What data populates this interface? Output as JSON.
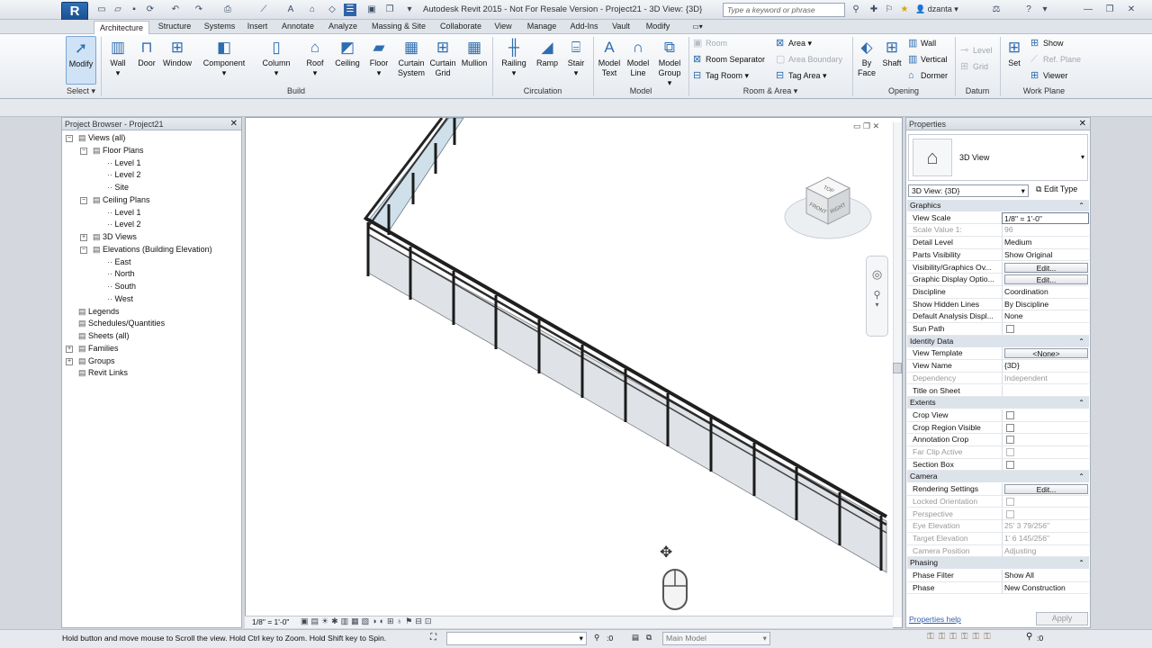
{
  "title_bar": {
    "window_title": "Autodesk Revit 2015 -  Not For Resale Version -    Project21 - 3D View: {3D}",
    "search_placeholder": "Type a keyword or phrase",
    "user": "dzanta",
    "app_letter": "R"
  },
  "tabs": [
    "Architecture",
    "Structure",
    "Systems",
    "Insert",
    "Annotate",
    "Analyze",
    "Massing & Site",
    "Collaborate",
    "View",
    "Manage",
    "Add-Ins",
    "Vault",
    "Modify"
  ],
  "ribbon": {
    "select": {
      "modify": "Modify",
      "label": "Select"
    },
    "build": {
      "wall": "Wall",
      "door": "Door",
      "window": "Window",
      "component": "Component",
      "column": "Column",
      "roof": "Roof",
      "ceiling": "Ceiling",
      "floor": "Floor",
      "curtain_system": "Curtain System",
      "curtain_grid": "Curtain Grid",
      "mullion": "Mullion",
      "label": "Build"
    },
    "circulation": {
      "railing": "Railing",
      "ramp": "Ramp",
      "stair": "Stair",
      "label": "Circulation"
    },
    "model": {
      "model_text": "Model Text",
      "model_line": "Model Line",
      "model_group": "Model Group",
      "label": "Model"
    },
    "room_area": {
      "room": "Room",
      "room_separator": "Room Separator",
      "tag_room": "Tag Room",
      "area": "Area",
      "area_boundary": "Area Boundary",
      "tag_area": "Tag Area",
      "label": "Room & Area"
    },
    "opening": {
      "by_face": "By Face",
      "shaft": "Shaft",
      "wall": "Wall",
      "vertical": "Vertical",
      "dormer": "Dormer",
      "label": "Opening"
    },
    "datum": {
      "level": "Level",
      "grid": "Grid",
      "label": "Datum"
    },
    "work_plane": {
      "set": "Set",
      "show": "Show",
      "ref_plane": "Ref. Plane",
      "viewer": "Viewer",
      "label": "Work Plane"
    }
  },
  "project_browser": {
    "title": "Project Browser - Project21",
    "items": [
      {
        "label": "Views (all)",
        "depth": 0,
        "toggle": "-"
      },
      {
        "label": "Floor Plans",
        "depth": 1,
        "toggle": "-"
      },
      {
        "label": "Level 1",
        "depth": 2,
        "toggle": ""
      },
      {
        "label": "Level 2",
        "depth": 2,
        "toggle": ""
      },
      {
        "label": "Site",
        "depth": 2,
        "toggle": ""
      },
      {
        "label": "Ceiling Plans",
        "depth": 1,
        "toggle": "-"
      },
      {
        "label": "Level 1",
        "depth": 2,
        "toggle": ""
      },
      {
        "label": "Level 2",
        "depth": 2,
        "toggle": ""
      },
      {
        "label": "3D Views",
        "depth": 1,
        "toggle": "+"
      },
      {
        "label": "Elevations (Building Elevation)",
        "depth": 1,
        "toggle": "-"
      },
      {
        "label": "East",
        "depth": 2,
        "toggle": ""
      },
      {
        "label": "North",
        "depth": 2,
        "toggle": ""
      },
      {
        "label": "South",
        "depth": 2,
        "toggle": ""
      },
      {
        "label": "West",
        "depth": 2,
        "toggle": ""
      },
      {
        "label": "Legends",
        "depth": 0,
        "toggle": ""
      },
      {
        "label": "Schedules/Quantities",
        "depth": 0,
        "toggle": ""
      },
      {
        "label": "Sheets (all)",
        "depth": 0,
        "toggle": ""
      },
      {
        "label": "Families",
        "depth": 0,
        "toggle": "+"
      },
      {
        "label": "Groups",
        "depth": 0,
        "toggle": "+"
      },
      {
        "label": "Revit Links",
        "depth": 0,
        "toggle": ""
      }
    ]
  },
  "view": {
    "scale": "1/8\" = 1'-0\"",
    "viewcube": {
      "top": "TOP",
      "front": "FRONT",
      "right": "RIGHT"
    }
  },
  "properties": {
    "title": "Properties",
    "type_name": "3D View",
    "view_selector": "3D View: {3D}",
    "edit_type": "Edit Type",
    "groups": {
      "graphics": "Graphics",
      "identity": "Identity Data",
      "extents": "Extents",
      "camera": "Camera",
      "phasing": "Phasing"
    },
    "rows": {
      "view_scale": {
        "k": "View Scale",
        "v": "1/8\" = 1'-0\""
      },
      "scale_value": {
        "k": "Scale Value    1:",
        "v": "96"
      },
      "detail_level": {
        "k": "Detail Level",
        "v": "Medium"
      },
      "parts_visibility": {
        "k": "Parts Visibility",
        "v": "Show Original"
      },
      "vis_graphics": {
        "k": "Visibility/Graphics Ov...",
        "v": "Edit..."
      },
      "graphic_display": {
        "k": "Graphic Display Optio...",
        "v": "Edit..."
      },
      "discipline": {
        "k": "Discipline",
        "v": "Coordination"
      },
      "hidden_lines": {
        "k": "Show Hidden Lines",
        "v": "By Discipline"
      },
      "default_analysis": {
        "k": "Default Analysis Displ...",
        "v": "None"
      },
      "sun_path": {
        "k": "Sun Path",
        "v": ""
      },
      "view_template": {
        "k": "View Template",
        "v": "<None>"
      },
      "view_name": {
        "k": "View Name",
        "v": "{3D}"
      },
      "dependency": {
        "k": "Dependency",
        "v": "Independent"
      },
      "title_on_sheet": {
        "k": "Title on Sheet",
        "v": ""
      },
      "crop_view": {
        "k": "Crop View",
        "v": ""
      },
      "crop_region": {
        "k": "Crop Region Visible",
        "v": ""
      },
      "annotation_crop": {
        "k": "Annotation Crop",
        "v": ""
      },
      "far_clip": {
        "k": "Far Clip Active",
        "v": ""
      },
      "section_box": {
        "k": "Section Box",
        "v": ""
      },
      "rendering": {
        "k": "Rendering Settings",
        "v": "Edit..."
      },
      "locked_orientation": {
        "k": "Locked Orientation",
        "v": ""
      },
      "perspective": {
        "k": "Perspective",
        "v": ""
      },
      "eye_elevation": {
        "k": "Eye Elevation",
        "v": "25'  3 79/256\""
      },
      "target_elevation": {
        "k": "Target Elevation",
        "v": "1'  6 145/256\""
      },
      "camera_position": {
        "k": "Camera Position",
        "v": "Adjusting"
      },
      "phase_filter": {
        "k": "Phase Filter",
        "v": "Show All"
      },
      "phase": {
        "k": "Phase",
        "v": "New Construction"
      }
    },
    "help": "Properties help",
    "apply": "Apply"
  },
  "status": {
    "message": "Hold button and move mouse to Scroll the view. Hold Ctrl key to Zoom. Hold Shift key to Spin.",
    "zero": ":0",
    "model": "Main Model",
    "select_label": "Select"
  }
}
